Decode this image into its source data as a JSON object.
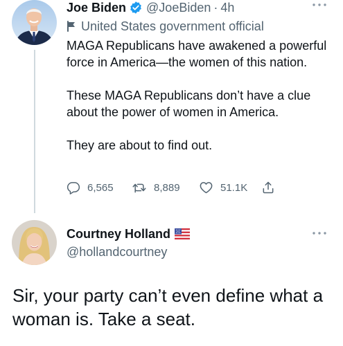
{
  "tweet": {
    "author_name": "Joe Biden",
    "handle": "@JoeBiden",
    "separator": "·",
    "time": "4h",
    "label": "United States government official",
    "paragraphs": [
      "MAGA Republicans have awakened a powerful force in America—the women of this nation.",
      "These MAGA Republicans don’t have a clue about the power of women in America.",
      "They are about to find out."
    ],
    "replies": "6,565",
    "retweets": "8,889",
    "likes": "51.1K"
  },
  "reply": {
    "author_name": "Courtney Holland",
    "handle": "@hollandcourtney",
    "text": "Sir, your party can’t even define what a woman is. Take a seat."
  },
  "icons": {
    "verified": "verified-badge-icon",
    "label": "flag-icon",
    "reply": "reply-icon",
    "retweet": "retweet-icon",
    "like": "heart-icon",
    "share": "share-icon",
    "more": "more-icon",
    "flag_emoji": "us-flag-icon"
  },
  "colors": {
    "text": "#0f1419",
    "secondary": "#536471",
    "verified": "#1d9bf0",
    "thread_line": "#cfd9de"
  }
}
